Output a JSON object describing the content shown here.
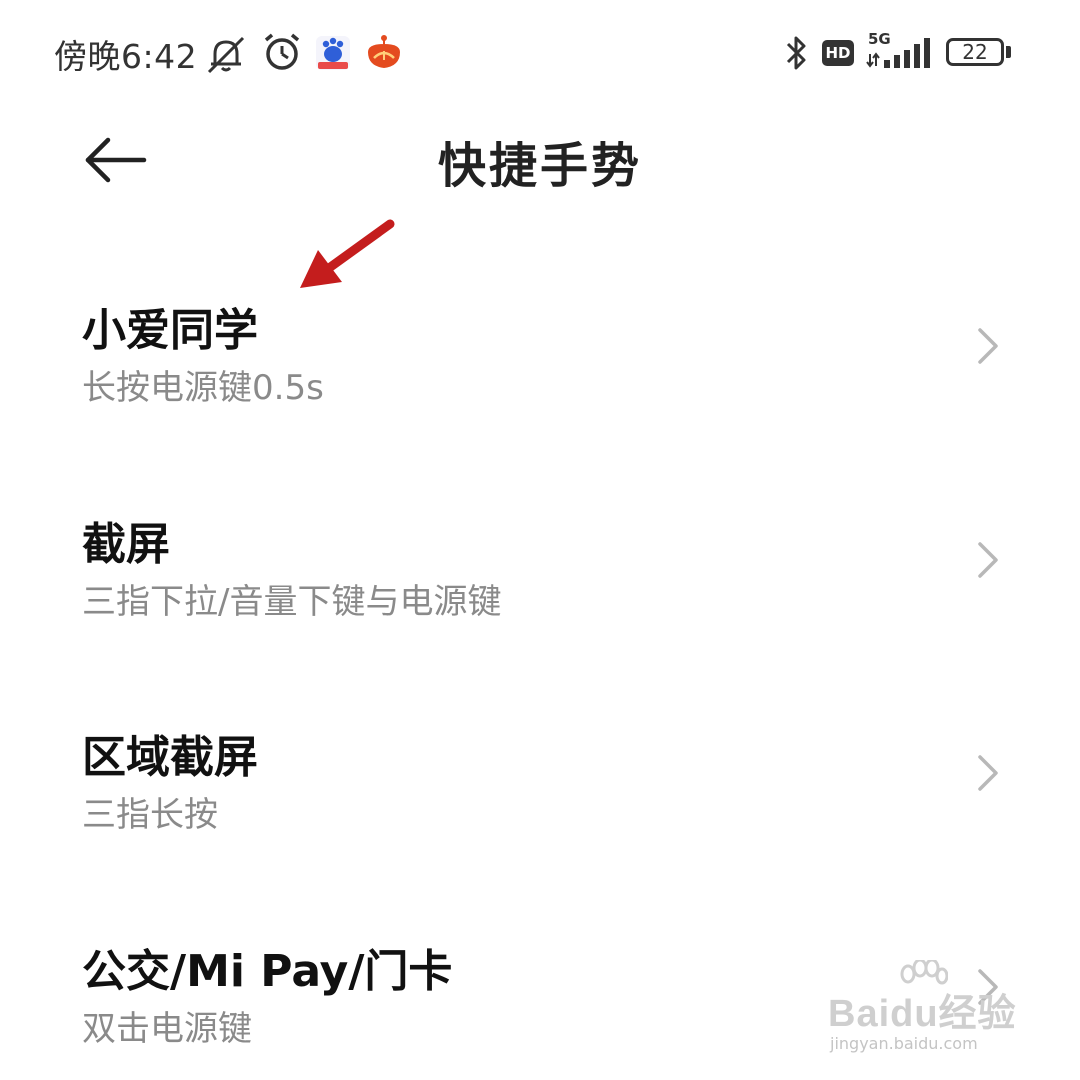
{
  "status_bar": {
    "time": "傍晚6:42",
    "hd_label": "HD",
    "network_label": "5G",
    "battery_level": "22"
  },
  "header": {
    "title": "快捷手势"
  },
  "items": [
    {
      "title": "小爱同学",
      "subtitle": "长按电源键0.5s"
    },
    {
      "title": "截屏",
      "subtitle": "三指下拉/音量下键与电源键"
    },
    {
      "title": "区域截屏",
      "subtitle": "三指长按"
    },
    {
      "title": "公交/Mi Pay/门卡",
      "subtitle": "双击电源键"
    }
  ],
  "annotation": {
    "color": "#c41d1d"
  },
  "watermark": {
    "logo": "Baidu经验",
    "url": "jingyan.baidu.com"
  }
}
